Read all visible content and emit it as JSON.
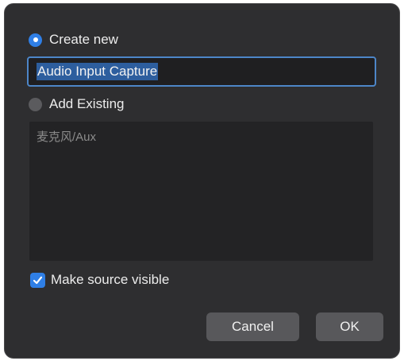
{
  "dialog": {
    "create_new": {
      "label": "Create new",
      "selected": true
    },
    "name_input": {
      "value": "Audio Input Capture"
    },
    "add_existing": {
      "label": "Add Existing",
      "selected": false
    },
    "existing_sources": [
      "麦克风/Aux"
    ],
    "make_visible": {
      "label": "Make source visible",
      "checked": true
    },
    "buttons": {
      "cancel": "Cancel",
      "ok": "OK"
    }
  },
  "colors": {
    "accent": "#2f7fe6",
    "dialog_bg": "#2e2e30",
    "field_border": "#4d86c8",
    "text_selection": "#2d5e9e",
    "button_bg": "#58585b"
  }
}
